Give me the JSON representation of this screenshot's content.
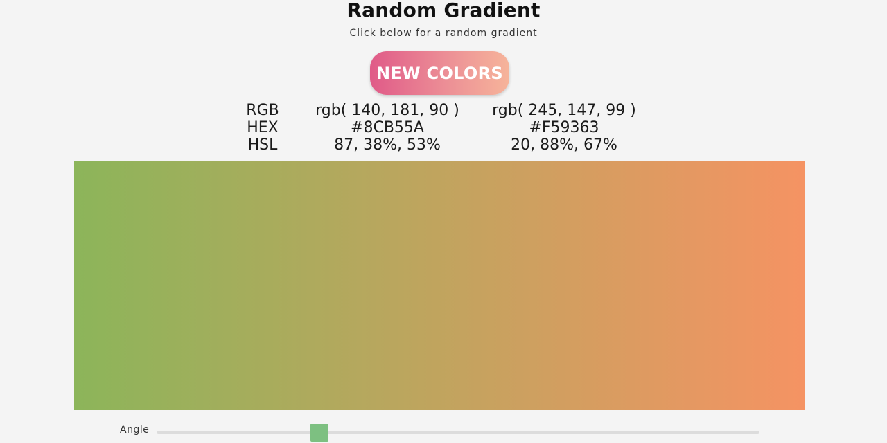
{
  "header": {
    "title": "Random Gradient",
    "subtitle": "Click below for a random gradient"
  },
  "button": {
    "label": "NEW COLORS"
  },
  "info": {
    "labels": [
      "RGB",
      "HEX",
      "HSL"
    ],
    "color1": {
      "rgb": "rgb( 140, 181, 90 )",
      "hex": "#8CB55A",
      "hsl": "87, 38%, 53%"
    },
    "color2": {
      "rgb": "rgb( 245, 147, 99 )",
      "hex": "#F59363",
      "hsl": "20, 88%, 67%"
    }
  },
  "gradient": {
    "start_color": "#8CB55A",
    "end_color": "#F59363",
    "angle_deg": 90
  },
  "slider": {
    "label": "Angle",
    "value_fraction": 0.27
  },
  "colors": {
    "background": "#f4f4f4",
    "button_start": "#e05a88",
    "button_end": "#f6b49a",
    "slider_thumb": "#7dc081",
    "slider_track": "#dcdcdc"
  }
}
